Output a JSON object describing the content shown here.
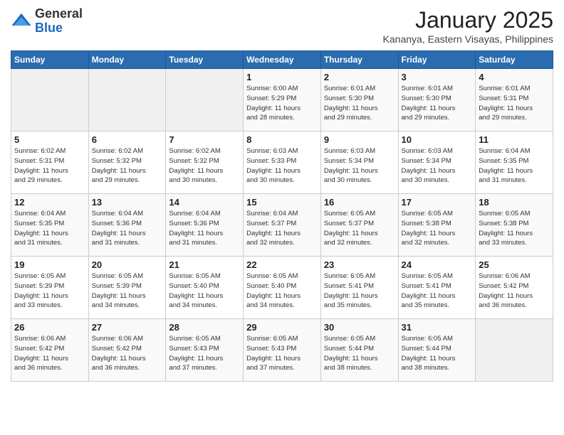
{
  "logo": {
    "general": "General",
    "blue": "Blue"
  },
  "title": "January 2025",
  "subtitle": "Kananya, Eastern Visayas, Philippines",
  "days_of_week": [
    "Sunday",
    "Monday",
    "Tuesday",
    "Wednesday",
    "Thursday",
    "Friday",
    "Saturday"
  ],
  "weeks": [
    [
      {
        "day": "",
        "info": ""
      },
      {
        "day": "",
        "info": ""
      },
      {
        "day": "",
        "info": ""
      },
      {
        "day": "1",
        "info": "Sunrise: 6:00 AM\nSunset: 5:29 PM\nDaylight: 11 hours\nand 28 minutes."
      },
      {
        "day": "2",
        "info": "Sunrise: 6:01 AM\nSunset: 5:30 PM\nDaylight: 11 hours\nand 29 minutes."
      },
      {
        "day": "3",
        "info": "Sunrise: 6:01 AM\nSunset: 5:30 PM\nDaylight: 11 hours\nand 29 minutes."
      },
      {
        "day": "4",
        "info": "Sunrise: 6:01 AM\nSunset: 5:31 PM\nDaylight: 11 hours\nand 29 minutes."
      }
    ],
    [
      {
        "day": "5",
        "info": "Sunrise: 6:02 AM\nSunset: 5:31 PM\nDaylight: 11 hours\nand 29 minutes."
      },
      {
        "day": "6",
        "info": "Sunrise: 6:02 AM\nSunset: 5:32 PM\nDaylight: 11 hours\nand 29 minutes."
      },
      {
        "day": "7",
        "info": "Sunrise: 6:02 AM\nSunset: 5:32 PM\nDaylight: 11 hours\nand 30 minutes."
      },
      {
        "day": "8",
        "info": "Sunrise: 6:03 AM\nSunset: 5:33 PM\nDaylight: 11 hours\nand 30 minutes."
      },
      {
        "day": "9",
        "info": "Sunrise: 6:03 AM\nSunset: 5:34 PM\nDaylight: 11 hours\nand 30 minutes."
      },
      {
        "day": "10",
        "info": "Sunrise: 6:03 AM\nSunset: 5:34 PM\nDaylight: 11 hours\nand 30 minutes."
      },
      {
        "day": "11",
        "info": "Sunrise: 6:04 AM\nSunset: 5:35 PM\nDaylight: 11 hours\nand 31 minutes."
      }
    ],
    [
      {
        "day": "12",
        "info": "Sunrise: 6:04 AM\nSunset: 5:35 PM\nDaylight: 11 hours\nand 31 minutes."
      },
      {
        "day": "13",
        "info": "Sunrise: 6:04 AM\nSunset: 5:36 PM\nDaylight: 11 hours\nand 31 minutes."
      },
      {
        "day": "14",
        "info": "Sunrise: 6:04 AM\nSunset: 5:36 PM\nDaylight: 11 hours\nand 31 minutes."
      },
      {
        "day": "15",
        "info": "Sunrise: 6:04 AM\nSunset: 5:37 PM\nDaylight: 11 hours\nand 32 minutes."
      },
      {
        "day": "16",
        "info": "Sunrise: 6:05 AM\nSunset: 5:37 PM\nDaylight: 11 hours\nand 32 minutes."
      },
      {
        "day": "17",
        "info": "Sunrise: 6:05 AM\nSunset: 5:38 PM\nDaylight: 11 hours\nand 32 minutes."
      },
      {
        "day": "18",
        "info": "Sunrise: 6:05 AM\nSunset: 5:38 PM\nDaylight: 11 hours\nand 33 minutes."
      }
    ],
    [
      {
        "day": "19",
        "info": "Sunrise: 6:05 AM\nSunset: 5:39 PM\nDaylight: 11 hours\nand 33 minutes."
      },
      {
        "day": "20",
        "info": "Sunrise: 6:05 AM\nSunset: 5:39 PM\nDaylight: 11 hours\nand 34 minutes."
      },
      {
        "day": "21",
        "info": "Sunrise: 6:05 AM\nSunset: 5:40 PM\nDaylight: 11 hours\nand 34 minutes."
      },
      {
        "day": "22",
        "info": "Sunrise: 6:05 AM\nSunset: 5:40 PM\nDaylight: 11 hours\nand 34 minutes."
      },
      {
        "day": "23",
        "info": "Sunrise: 6:05 AM\nSunset: 5:41 PM\nDaylight: 11 hours\nand 35 minutes."
      },
      {
        "day": "24",
        "info": "Sunrise: 6:05 AM\nSunset: 5:41 PM\nDaylight: 11 hours\nand 35 minutes."
      },
      {
        "day": "25",
        "info": "Sunrise: 6:06 AM\nSunset: 5:42 PM\nDaylight: 11 hours\nand 36 minutes."
      }
    ],
    [
      {
        "day": "26",
        "info": "Sunrise: 6:06 AM\nSunset: 5:42 PM\nDaylight: 11 hours\nand 36 minutes."
      },
      {
        "day": "27",
        "info": "Sunrise: 6:06 AM\nSunset: 5:42 PM\nDaylight: 11 hours\nand 36 minutes."
      },
      {
        "day": "28",
        "info": "Sunrise: 6:05 AM\nSunset: 5:43 PM\nDaylight: 11 hours\nand 37 minutes."
      },
      {
        "day": "29",
        "info": "Sunrise: 6:05 AM\nSunset: 5:43 PM\nDaylight: 11 hours\nand 37 minutes."
      },
      {
        "day": "30",
        "info": "Sunrise: 6:05 AM\nSunset: 5:44 PM\nDaylight: 11 hours\nand 38 minutes."
      },
      {
        "day": "31",
        "info": "Sunrise: 6:05 AM\nSunset: 5:44 PM\nDaylight: 11 hours\nand 38 minutes."
      },
      {
        "day": "",
        "info": ""
      }
    ]
  ]
}
